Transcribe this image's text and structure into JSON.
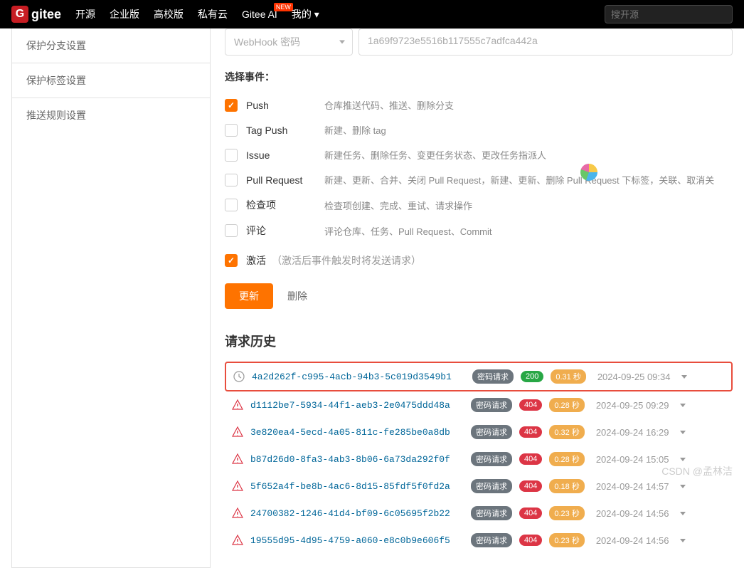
{
  "header": {
    "logo": "gitee",
    "nav": [
      "开源",
      "企业版",
      "高校版",
      "私有云",
      "Gitee AI",
      "我的"
    ],
    "new_badge": "NEW",
    "search_placeholder": "搜开源"
  },
  "sidebar": {
    "items": [
      "保护分支设置",
      "保护标签设置",
      "推送规则设置"
    ]
  },
  "form": {
    "select_label": "WebHook 密码",
    "token_value": "1a69f9723e5516b117555c7adfca442a",
    "events_label": "选择事件：",
    "events": [
      {
        "name": "Push",
        "desc": "仓库推送代码、推送、删除分支",
        "checked": true
      },
      {
        "name": "Tag Push",
        "desc": "新建、删除 tag",
        "checked": false
      },
      {
        "name": "Issue",
        "desc": "新建任务、删除任务、变更任务状态、更改任务指派人",
        "checked": false
      },
      {
        "name": "Pull Request",
        "desc": "新建、更新、合并、关闭 Pull Request，新建、更新、删除 Pull Request 下标签，关联、取消关",
        "checked": false
      },
      {
        "name": "检查项",
        "desc": "检查项创建、完成、重试、请求操作",
        "checked": false
      },
      {
        "name": "评论",
        "desc": "评论仓库、任务、Pull Request、Commit",
        "checked": false
      }
    ],
    "activate_label": "激活",
    "activate_desc": "（激活后事件触发时将发送请求）",
    "update_btn": "更新",
    "delete_btn": "删除"
  },
  "history": {
    "title": "请求历史",
    "badge_pwd": "密码请求",
    "items": [
      {
        "id": "4a2d262f-c995-4acb-94b3-5c019d3549b1",
        "status": "200",
        "duration": "0.31 秒",
        "time": "2024-09-25 09:34",
        "ok": true,
        "highlight": true
      },
      {
        "id": "d1112be7-5934-44f1-aeb3-2e0475ddd48a",
        "status": "404",
        "duration": "0.28 秒",
        "time": "2024-09-25 09:29",
        "ok": false
      },
      {
        "id": "3e820ea4-5ecd-4a05-811c-fe285be0a8db",
        "status": "404",
        "duration": "0.32 秒",
        "time": "2024-09-24 16:29",
        "ok": false
      },
      {
        "id": "b87d26d0-8fa3-4ab3-8b06-6a73da292f0f",
        "status": "404",
        "duration": "0.28 秒",
        "time": "2024-09-24 15:05",
        "ok": false
      },
      {
        "id": "5f652a4f-be8b-4ac6-8d15-85fdf5f0fd2a",
        "status": "404",
        "duration": "0.18 秒",
        "time": "2024-09-24 14:57",
        "ok": false
      },
      {
        "id": "24700382-1246-41d4-bf09-6c05695f2b22",
        "status": "404",
        "duration": "0.23 秒",
        "time": "2024-09-24 14:56",
        "ok": false
      },
      {
        "id": "19555d95-4d95-4759-a060-e8c0b9e606f5",
        "status": "404",
        "duration": "0.23 秒",
        "time": "2024-09-24 14:56",
        "ok": false
      }
    ]
  },
  "watermark": "CSDN @孟林洁"
}
